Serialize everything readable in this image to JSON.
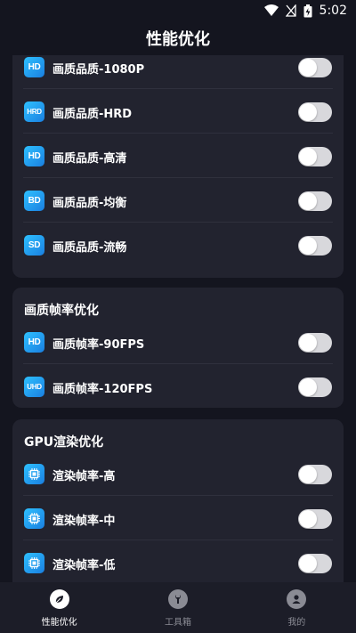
{
  "statusbar": {
    "time": "5:02"
  },
  "header": {
    "title": "性能优化"
  },
  "cards": [
    {
      "title": "",
      "rows": [
        {
          "badge": "HD",
          "label": "画质品质-1080P",
          "on": false
        },
        {
          "badge": "HRD",
          "label": "画质品质-HRD",
          "on": false
        },
        {
          "badge": "HD",
          "label": "画质品质-高清",
          "on": false
        },
        {
          "badge": "BD",
          "label": "画质品质-均衡",
          "on": false
        },
        {
          "badge": "SD",
          "label": "画质品质-流畅",
          "on": false
        }
      ]
    },
    {
      "title": "画质帧率优化",
      "rows": [
        {
          "badge": "HD",
          "label": "画质帧率-90FPS",
          "on": false
        },
        {
          "badge": "UHD",
          "label": "画质帧率-120FPS",
          "on": false
        }
      ]
    },
    {
      "title": "GPU渲染优化",
      "rows": [
        {
          "badge": "chip-icon",
          "label": "渲染帧率-高",
          "on": false
        },
        {
          "badge": "chip-icon",
          "label": "渲染帧率-中",
          "on": false
        },
        {
          "badge": "chip-icon",
          "label": "渲染帧率-低",
          "on": false
        }
      ]
    }
  ],
  "nav": [
    {
      "label": "性能优化",
      "icon": "leaf-icon",
      "active": true
    },
    {
      "label": "工具箱",
      "icon": "wrench-icon",
      "active": false
    },
    {
      "label": "我的",
      "icon": "user-icon",
      "active": false
    }
  ],
  "colors": {
    "background": "#14151f",
    "card": "#22232f",
    "accent": "#1a9fff"
  }
}
